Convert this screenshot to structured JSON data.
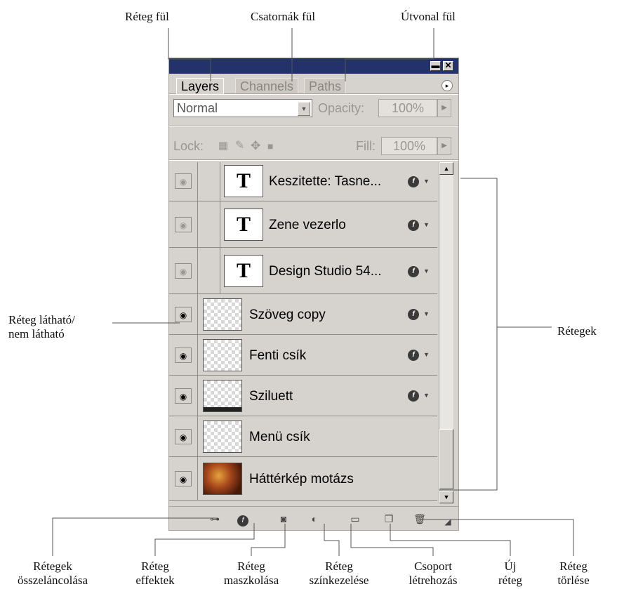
{
  "callouts": {
    "reteg_ful": "Réteg fül",
    "csatornak_ful": "Csatornák fül",
    "utvonal_ful": "Útvonal fül",
    "lathato_1": "Réteg látható/",
    "lathato_2": "nem látható",
    "retegek": "Rétegek",
    "osszelanc_1": "Rétegek",
    "osszelanc_2": "összeláncolása",
    "effektek_1": "Réteg",
    "effektek_2": "effektek",
    "maszk_1": "Réteg",
    "maszk_2": "maszkolása",
    "szinkezel_1": "Réteg",
    "szinkezel_2": "színkezelése",
    "csoport_1": "Csoport",
    "csoport_2": "létrehozás",
    "uj_1": "Új",
    "uj_2": "réteg",
    "torles_1": "Réteg",
    "torles_2": "törlése"
  },
  "panel": {
    "tabs": [
      "Layers",
      "Channels",
      "Paths"
    ],
    "blend_mode": "Normal",
    "opacity_label": "Opacity:",
    "opacity_value": "100%",
    "lock_label": "Lock:",
    "fill_label": "Fill:",
    "fill_value": "100%",
    "layers": [
      {
        "name": "Keszitette: Tasne...",
        "type": "text",
        "effects": true
      },
      {
        "name": "Zene vezerlo",
        "type": "text",
        "effects": true
      },
      {
        "name": "Design Studio 54...",
        "type": "text",
        "effects": true
      },
      {
        "name": "Szöveg copy",
        "type": "raster",
        "effects": true
      },
      {
        "name": "Fenti csík",
        "type": "raster",
        "effects": true
      },
      {
        "name": "Sziluett",
        "type": "raster",
        "effects": true
      },
      {
        "name": "Menü csík",
        "type": "raster",
        "effects": false
      },
      {
        "name": "Háttérkép motázs",
        "type": "image",
        "effects": false
      }
    ],
    "icons": {
      "eye": "eye-icon",
      "link": "link-icon",
      "fx": "fx-icon",
      "mask": "mask-icon",
      "adjustment": "adjustment-icon",
      "folder": "folder-icon",
      "new_layer": "new-layer-icon",
      "trash": "trash-icon"
    }
  }
}
